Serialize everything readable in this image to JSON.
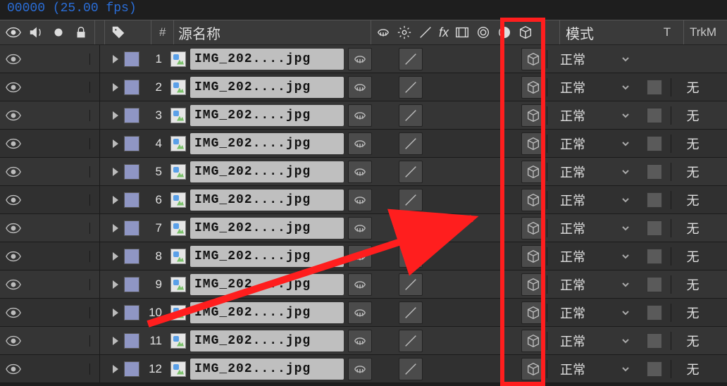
{
  "top_info": "00000 (25.00 fps)",
  "header": {
    "source_name_label": "源名称",
    "hash_label": "#",
    "mode_label": "模式",
    "t_label": "T",
    "trk_label": "TrkM"
  },
  "blend_mode_default": "正常",
  "track_matte_default": "无",
  "layers": [
    {
      "index": 1,
      "name": "IMG_202....jpg",
      "mode": "正常",
      "track": ""
    },
    {
      "index": 2,
      "name": "IMG_202....jpg",
      "mode": "正常",
      "track": "无"
    },
    {
      "index": 3,
      "name": "IMG_202....jpg",
      "mode": "正常",
      "track": "无"
    },
    {
      "index": 4,
      "name": "IMG_202....jpg",
      "mode": "正常",
      "track": "无"
    },
    {
      "index": 5,
      "name": "IMG_202....jpg",
      "mode": "正常",
      "track": "无"
    },
    {
      "index": 6,
      "name": "IMG_202....jpg",
      "mode": "正常",
      "track": "无"
    },
    {
      "index": 7,
      "name": "IMG_202....jpg",
      "mode": "正常",
      "track": "无"
    },
    {
      "index": 8,
      "name": "IMG_202....jpg",
      "mode": "正常",
      "track": "无"
    },
    {
      "index": 9,
      "name": "IMG_202....jpg",
      "mode": "正常",
      "track": "无"
    },
    {
      "index": 10,
      "name": "IMG_202....jpg",
      "mode": "正常",
      "track": "无"
    },
    {
      "index": 11,
      "name": "IMG_202....jpg",
      "mode": "正常",
      "track": "无"
    },
    {
      "index": 12,
      "name": "IMG_202....jpg",
      "mode": "正常",
      "track": "无"
    }
  ]
}
